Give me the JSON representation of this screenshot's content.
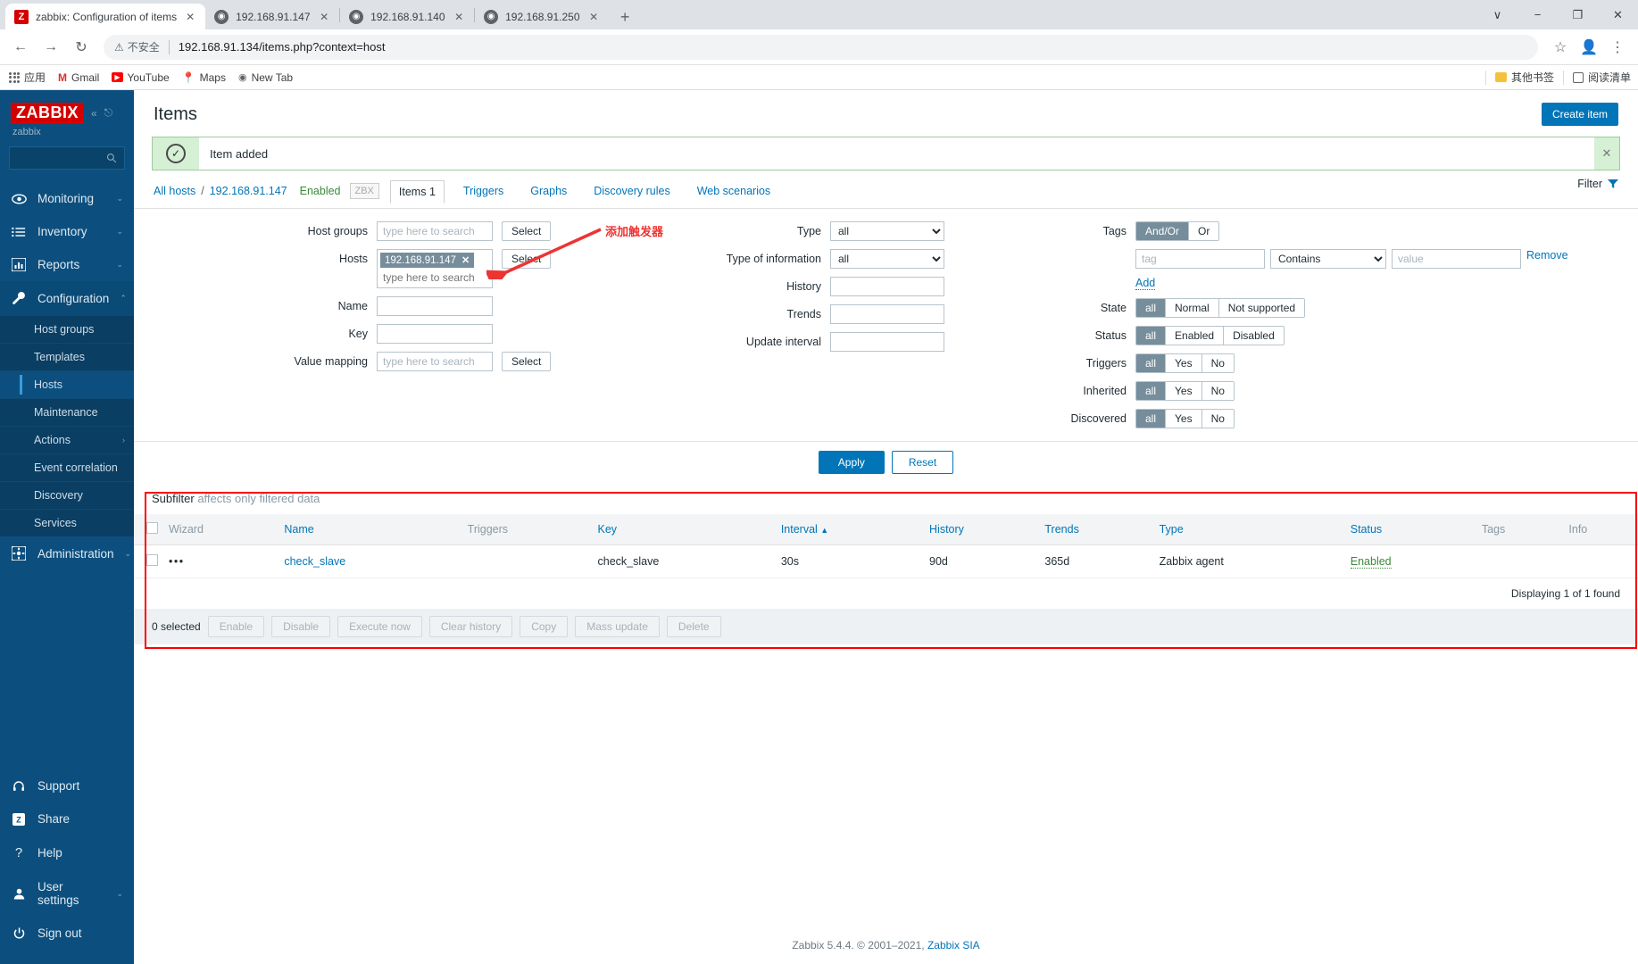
{
  "browser": {
    "tabs": [
      {
        "title": "zabbix: Configuration of items",
        "icon": "zabbix-favicon",
        "active": true
      },
      {
        "title": "192.168.91.147",
        "icon": "globe-favicon",
        "active": false
      },
      {
        "title": "192.168.91.140",
        "icon": "globe-favicon",
        "active": false
      },
      {
        "title": "192.168.91.250",
        "icon": "globe-favicon",
        "active": false
      }
    ],
    "new_tab_label": "+",
    "window_controls": {
      "tablist": "∨",
      "minimize": "−",
      "maximize": "❐",
      "close": "✕"
    },
    "address": {
      "security_label": "不安全",
      "url": "192.168.91.134/items.php?context=host"
    },
    "bookmarks": [
      {
        "label": "应用",
        "icon": "apps-grid-icon"
      },
      {
        "label": "Gmail",
        "icon": "gmail-icon"
      },
      {
        "label": "YouTube",
        "icon": "youtube-icon"
      },
      {
        "label": "Maps",
        "icon": "maps-icon"
      },
      {
        "label": "New Tab",
        "icon": "globe-icon"
      }
    ],
    "bookmarks_right": [
      {
        "label": "其他书签",
        "icon": "folder-icon"
      },
      {
        "label": "阅读清单",
        "icon": "reading-list-icon"
      }
    ]
  },
  "sidebar": {
    "logo": "ZABBIX",
    "user": "zabbix",
    "search_placeholder": "",
    "nav": [
      {
        "label": "Monitoring",
        "icon": "eye-icon",
        "chevron": "⌄"
      },
      {
        "label": "Inventory",
        "icon": "list-icon",
        "chevron": "⌄"
      },
      {
        "label": "Reports",
        "icon": "bar-chart-icon",
        "chevron": "⌄"
      },
      {
        "label": "Configuration",
        "icon": "wrench-icon",
        "chevron": "⌃",
        "expanded": true
      },
      {
        "label": "Administration",
        "icon": "gear-icon",
        "chevron": "⌄"
      }
    ],
    "config_subitems": [
      {
        "label": "Host groups"
      },
      {
        "label": "Templates"
      },
      {
        "label": "Hosts",
        "active": true
      },
      {
        "label": "Maintenance"
      },
      {
        "label": "Actions",
        "chevron": "›"
      },
      {
        "label": "Event correlation"
      },
      {
        "label": "Discovery"
      },
      {
        "label": "Services"
      }
    ],
    "bottom": [
      {
        "label": "Support",
        "icon": "headset-icon"
      },
      {
        "label": "Share",
        "icon": "zabbix-square-icon"
      },
      {
        "label": "Help",
        "icon": "question-icon"
      },
      {
        "label": "User settings",
        "icon": "user-icon",
        "chevron": "⌄"
      },
      {
        "label": "Sign out",
        "icon": "power-icon"
      }
    ]
  },
  "page": {
    "title": "Items",
    "create_button": "Create item",
    "message": {
      "text": "Item added",
      "icon": "check-circle-icon",
      "close": "✕"
    },
    "annotation": {
      "text": "添加触发器",
      "color": "#ee3333"
    }
  },
  "breadcrumb": {
    "all_hosts": "All hosts",
    "separator": "/",
    "host": "192.168.91.147",
    "status": "Enabled",
    "agent_badge": "ZBX",
    "tabs": [
      {
        "label": "Items 1",
        "active": true
      },
      {
        "label": "Triggers",
        "active": false
      },
      {
        "label": "Graphs",
        "active": false
      },
      {
        "label": "Discovery rules",
        "active": false
      },
      {
        "label": "Web scenarios",
        "active": false
      }
    ],
    "filter_tab": "Filter"
  },
  "filter": {
    "host_groups": {
      "label": "Host groups",
      "placeholder": "type here to search",
      "select": "Select"
    },
    "hosts": {
      "label": "Hosts",
      "chip": "192.168.91.147",
      "chip_remove": "✕",
      "placeholder": "type here to search",
      "select": "Select"
    },
    "name": {
      "label": "Name",
      "value": ""
    },
    "key": {
      "label": "Key",
      "value": ""
    },
    "value_mapping": {
      "label": "Value mapping",
      "placeholder": "type here to search",
      "select": "Select"
    },
    "type": {
      "label": "Type",
      "value": "all"
    },
    "type_of_information": {
      "label": "Type of information",
      "value": "all"
    },
    "history": {
      "label": "History",
      "value": ""
    },
    "trends": {
      "label": "Trends",
      "value": ""
    },
    "update_interval": {
      "label": "Update interval",
      "value": ""
    },
    "tags": {
      "label": "Tags",
      "operator_options": [
        {
          "label": "And/Or",
          "selected": true
        },
        {
          "label": "Or",
          "selected": false
        }
      ],
      "tag_placeholder": "tag",
      "condition": "Contains",
      "value_placeholder": "value",
      "remove": "Remove",
      "add": "Add"
    },
    "state": {
      "label": "State",
      "options": [
        {
          "label": "all",
          "selected": true
        },
        {
          "label": "Normal",
          "selected": false
        },
        {
          "label": "Not supported",
          "selected": false
        }
      ]
    },
    "status": {
      "label": "Status",
      "options": [
        {
          "label": "all",
          "selected": true
        },
        {
          "label": "Enabled",
          "selected": false
        },
        {
          "label": "Disabled",
          "selected": false
        }
      ]
    },
    "triggers": {
      "label": "Triggers",
      "options": [
        {
          "label": "all",
          "selected": true
        },
        {
          "label": "Yes",
          "selected": false
        },
        {
          "label": "No",
          "selected": false
        }
      ]
    },
    "inherited": {
      "label": "Inherited",
      "options": [
        {
          "label": "all",
          "selected": true
        },
        {
          "label": "Yes",
          "selected": false
        },
        {
          "label": "No",
          "selected": false
        }
      ]
    },
    "discovered": {
      "label": "Discovered",
      "options": [
        {
          "label": "all",
          "selected": true
        },
        {
          "label": "Yes",
          "selected": false
        },
        {
          "label": "No",
          "selected": false
        }
      ]
    },
    "apply": "Apply",
    "reset": "Reset"
  },
  "subfilter": {
    "title": "Subfilter",
    "note": "affects only filtered data"
  },
  "table": {
    "columns": [
      {
        "label": "Wizard",
        "link": false
      },
      {
        "label": "Name",
        "link": true
      },
      {
        "label": "Triggers",
        "link": false
      },
      {
        "label": "Key",
        "link": true
      },
      {
        "label": "Interval",
        "link": true,
        "sort": "▲"
      },
      {
        "label": "History",
        "link": true
      },
      {
        "label": "Trends",
        "link": true
      },
      {
        "label": "Type",
        "link": true
      },
      {
        "label": "Status",
        "link": true
      },
      {
        "label": "Tags",
        "link": false
      },
      {
        "label": "Info",
        "link": false
      }
    ],
    "rows": [
      {
        "wizard": "•••",
        "name": "check_slave",
        "triggers": "",
        "key": "check_slave",
        "interval": "30s",
        "history": "90d",
        "trends": "365d",
        "type": "Zabbix agent",
        "status": "Enabled",
        "tags": "",
        "info": ""
      }
    ],
    "displaying": "Displaying 1 of 1 found"
  },
  "footer_actions": {
    "selected_count": "0 selected",
    "buttons": [
      "Enable",
      "Disable",
      "Execute now",
      "Clear history",
      "Copy",
      "Mass update",
      "Delete"
    ]
  },
  "footer": {
    "version": "Zabbix 5.4.4. © 2001–2021,",
    "link": "Zabbix SIA"
  }
}
